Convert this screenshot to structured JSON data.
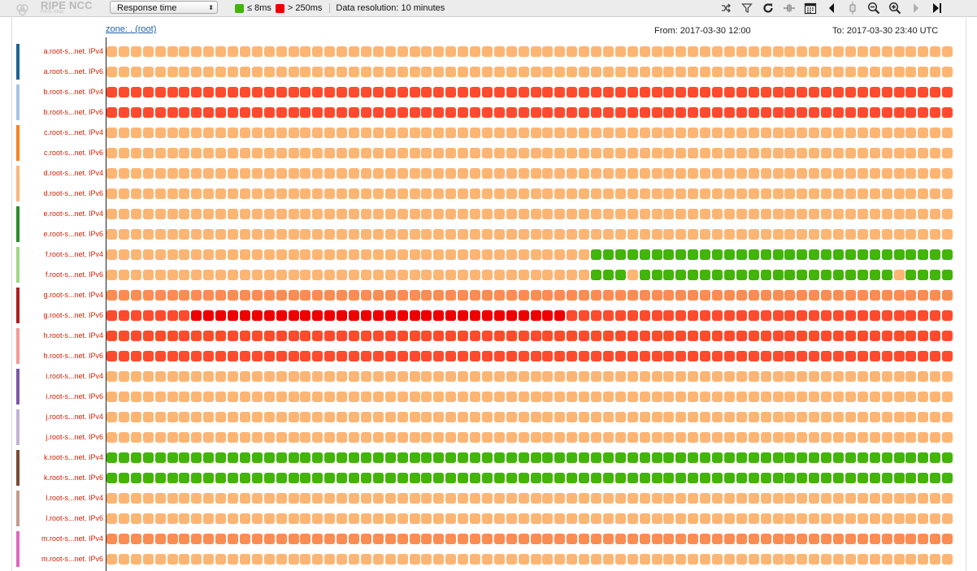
{
  "header": {
    "logo_name": "RIPE NCC",
    "logo_sub": "RIPE Atlas",
    "metric_select": "Response time",
    "legend_low": "≤ 8ms",
    "legend_high": "> 250ms",
    "resolution": "Data resolution: 10 minutes",
    "toolbar_icons": [
      "shuffle-icon",
      "filter-icon",
      "refresh-icon",
      "collapse-icon",
      "calendar-icon",
      "step-back-icon",
      "zoom-slider-icon",
      "zoom-out-icon",
      "zoom-in-icon",
      "step-forward-icon",
      "jump-end-icon"
    ]
  },
  "info": {
    "zone": "zone: . (root)",
    "from": "From: 2017-03-30 12:00",
    "to": "To: 2017-03-30 23:40 UTC"
  },
  "colors": {
    "green": "#42b40a",
    "light_orange": "#fdb574",
    "orange": "#fb8c52",
    "red_orange": "#fe4b2d",
    "red": "#ee0000",
    "label_red": "#d41e00"
  },
  "rows": [
    {
      "label": "a.root-s...net. IPv4",
      "bar_color": "#1f6396",
      "cells": [
        {
          "color": "light_orange",
          "count": 70
        }
      ]
    },
    {
      "label": "a.root-s...net. IPv6",
      "cells": [
        {
          "color": "light_orange",
          "count": 70
        }
      ]
    },
    {
      "label": "b.root-s...net. IPv4",
      "bar_color": "#a6c4e6",
      "cells": [
        {
          "color": "red_orange",
          "count": 70
        }
      ]
    },
    {
      "label": "b.root-s...net. IPv6",
      "cells": [
        {
          "color": "red_orange",
          "count": 70
        }
      ]
    },
    {
      "label": "c.root-s...net. IPv4",
      "bar_color": "#f6821f",
      "cells": [
        {
          "color": "light_orange",
          "count": 70
        }
      ]
    },
    {
      "label": "c.root-s...net. IPv6",
      "cells": [
        {
          "color": "light_orange",
          "count": 70
        }
      ]
    },
    {
      "label": "d.root-s...net. IPv4",
      "bar_color": "#fbb77a",
      "cells": [
        {
          "color": "light_orange",
          "count": 70
        }
      ]
    },
    {
      "label": "d.root-s...net. IPv6",
      "cells": [
        {
          "color": "light_orange",
          "count": 70
        }
      ]
    },
    {
      "label": "e.root-s...net. IPv4",
      "bar_color": "#2a8d2a",
      "cells": [
        {
          "color": "light_orange",
          "count": 70
        }
      ]
    },
    {
      "label": "e.root-s...net. IPv6",
      "cells": [
        {
          "color": "light_orange",
          "count": 70
        }
      ]
    },
    {
      "label": "f.root-s...net. IPv4",
      "bar_color": "#9ed88a",
      "cells": [
        {
          "color": "light_orange",
          "count": 40
        },
        {
          "color": "green",
          "count": 30
        }
      ]
    },
    {
      "label": "f.root-s...net. IPv6",
      "cells": [
        {
          "color": "light_orange",
          "count": 40
        },
        {
          "color": "green",
          "count": 3
        },
        {
          "color": "light_orange",
          "count": 1
        },
        {
          "color": "green",
          "count": 21
        },
        {
          "color": "light_orange",
          "count": 1
        },
        {
          "color": "green",
          "count": 4
        }
      ]
    },
    {
      "label": "g.root-s...net. IPv4",
      "bar_color": "#b11e1e",
      "cells": [
        {
          "color": "orange",
          "count": 70
        }
      ]
    },
    {
      "label": "g.root-s...net. IPv6",
      "cells": [
        {
          "color": "red_orange",
          "count": 7
        },
        {
          "color": "red",
          "count": 31
        },
        {
          "color": "red_orange",
          "count": 32
        }
      ]
    },
    {
      "label": "h.root-s...net. IPv4",
      "bar_color": "#f59a96",
      "cells": [
        {
          "color": "red_orange",
          "count": 70
        }
      ]
    },
    {
      "label": "h.root-s...net. IPv6",
      "cells": [
        {
          "color": "red_orange",
          "count": 70
        }
      ]
    },
    {
      "label": "i.root-s...net. IPv4",
      "bar_color": "#7d57a8",
      "cells": [
        {
          "color": "light_orange",
          "count": 70
        }
      ]
    },
    {
      "label": "i.root-s...net. IPv6",
      "cells": [
        {
          "color": "light_orange",
          "count": 70
        }
      ]
    },
    {
      "label": "j.root-s...net. IPv4",
      "bar_color": "#c2b3d6",
      "cells": [
        {
          "color": "light_orange",
          "count": 70
        }
      ]
    },
    {
      "label": "j.root-s...net. IPv6",
      "cells": [
        {
          "color": "light_orange",
          "count": 70
        }
      ]
    },
    {
      "label": "k.root-s...net. IPv4",
      "bar_color": "#7a4a34",
      "cells": [
        {
          "color": "green",
          "count": 70
        }
      ]
    },
    {
      "label": "k.root-s...net. IPv6",
      "cells": [
        {
          "color": "green",
          "count": 70
        }
      ]
    },
    {
      "label": "l.root-s...net. IPv4",
      "bar_color": "#c39b8e",
      "cells": [
        {
          "color": "light_orange",
          "count": 70
        }
      ]
    },
    {
      "label": "l.root-s...net. IPv6",
      "cells": [
        {
          "color": "light_orange",
          "count": 70
        }
      ]
    },
    {
      "label": "m.root-s...net. IPv4",
      "bar_color": "#e066c0",
      "cells": [
        {
          "color": "orange",
          "count": 70
        }
      ]
    },
    {
      "label": "m.root-s...net. IPv6",
      "cells": [
        {
          "color": "light_orange",
          "count": 70
        }
      ]
    }
  ]
}
